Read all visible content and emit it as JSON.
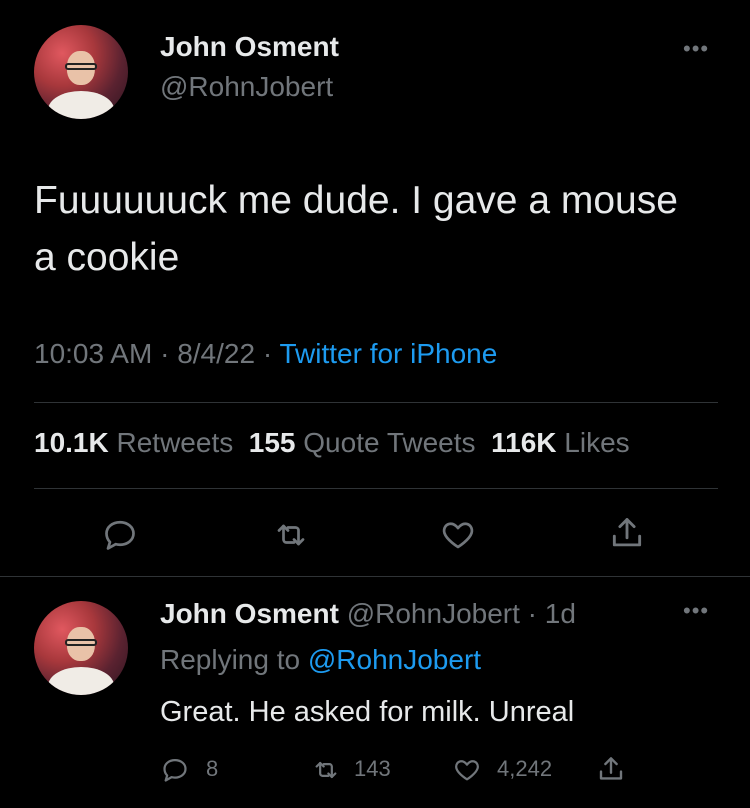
{
  "tweet": {
    "author_name": "John Osment",
    "author_handle": "@RohnJobert",
    "text": "Fuuuuuuck me dude. I gave a mouse a cookie",
    "time": "10:03 AM",
    "date": "8/4/22",
    "source": "Twitter for iPhone",
    "stats": {
      "retweets_count": "10.1K",
      "retweets_label": "Retweets",
      "quotes_count": "155",
      "quotes_label": "Quote Tweets",
      "likes_count": "116K",
      "likes_label": "Likes"
    },
    "actions": [
      "reply-icon",
      "retweet-icon",
      "like-icon",
      "share-icon"
    ]
  },
  "reply": {
    "author_name": "John Osment",
    "author_handle": "@RohnJobert",
    "age": "1d",
    "replying_prefix": "Replying to",
    "replying_to": "@RohnJobert",
    "text": "Great. He asked for milk. Unreal",
    "reply_count": "8",
    "retweet_count": "143",
    "like_count": "4,242"
  },
  "colors": {
    "background": "#000000",
    "text": "#e7e9ea",
    "secondary": "#71767b",
    "link": "#1d9bf0",
    "divider": "#2f3336"
  }
}
